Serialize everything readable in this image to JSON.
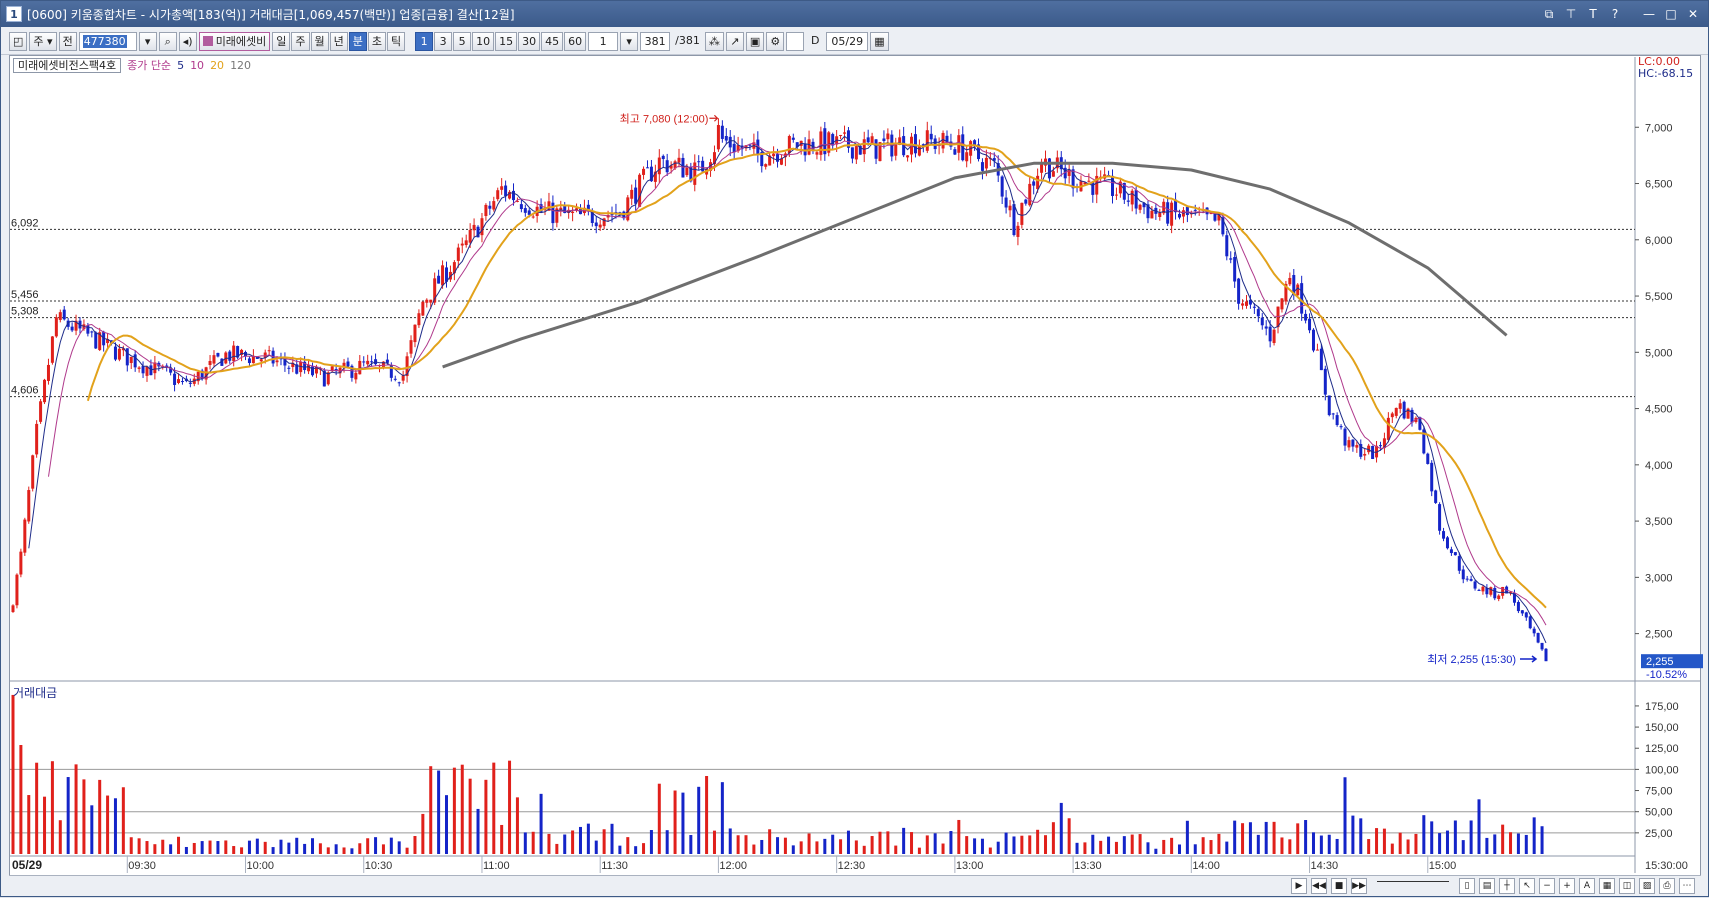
{
  "window": {
    "number": "1",
    "title": "[0600] 키움종합차트 - 시가총액[183(억)] 거래대금[1,069,457(백만)] 업종[금융] 결산[12월]",
    "buttons": [
      "restore-icon",
      "pin-icon",
      "font-icon",
      "help-icon",
      "minimize-icon",
      "maximize-icon",
      "close-icon"
    ]
  },
  "toolbar": {
    "type_select": "주",
    "all_label": "전",
    "stock_code": "477380",
    "stock_name": "미래에셋비",
    "periods": [
      "일",
      "주",
      "월",
      "년",
      "분",
      "초",
      "틱"
    ],
    "selected_period": "분",
    "intervals": [
      "1",
      "3",
      "5",
      "10",
      "15",
      "30",
      "45",
      "60"
    ],
    "selected_interval": "1",
    "interval_input": "1",
    "count_current": "381",
    "count_total": "/381",
    "date_checkbox_label": "D",
    "date_value": "05/29"
  },
  "price_panel": {
    "stock_name": "미래에셋비전스팩4호",
    "ma_label": "종가 단순",
    "ma_periods": [
      {
        "label": "5",
        "color": "#1f2d8a"
      },
      {
        "label": "10",
        "color": "#b03a8c"
      },
      {
        "label": "20",
        "color": "#e2a21b"
      },
      {
        "label": "120",
        "color": "#777777"
      }
    ],
    "lc": "LC:0.00",
    "hc": "HC:-68.15",
    "high_annotation": "최고 7,080 (12:00)",
    "low_annotation": "최저 2,255 (15:30)",
    "current_price": "2,255",
    "current_change": "-10.52%"
  },
  "volume_panel": {
    "title": "거래대금"
  },
  "time_axis": {
    "date_label": "05/29",
    "end_label": "15:30:00"
  },
  "colors": {
    "up": "#e0201b",
    "down": "#1424c8",
    "ma5": "#1f2d8a",
    "ma10": "#b03a8c",
    "ma20": "#e2a21b",
    "ma120": "#6e6e6e",
    "price_box": "#2457c8"
  },
  "chart_data": [
    {
      "type": "candlestick",
      "title": "미래에셋비전스팩4호",
      "x_ticks": [
        "09:30",
        "10:00",
        "10:30",
        "11:00",
        "11:30",
        "12:00",
        "12:30",
        "13:00",
        "13:30",
        "14:00",
        "14:30",
        "15:00"
      ],
      "y_ticks": [
        "7,000",
        "6,500",
        "6,000",
        "5,500",
        "5,000",
        "4,500",
        "4,000",
        "3,500",
        "3,000",
        "2,500"
      ],
      "ylim": [
        2150,
        7500
      ],
      "y_scale": "linear",
      "grid": false,
      "horizontal_levels": [
        {
          "label": "6,092",
          "value": 6092
        },
        {
          "label": "5,456",
          "value": 5456
        },
        {
          "label": "5,308",
          "value": 5308
        },
        {
          "label": "4,606",
          "value": 4606
        }
      ],
      "high": {
        "value": 7080,
        "time": "12:00"
      },
      "low": {
        "value": 2255,
        "time": "15:30"
      },
      "close": 2255,
      "change_pct": -10.52,
      "path_points": [
        {
          "t": "09:01",
          "p": 2800
        },
        {
          "t": "09:03",
          "p": 3200
        },
        {
          "t": "09:07",
          "p": 4300
        },
        {
          "t": "09:12",
          "p": 5300
        },
        {
          "t": "09:20",
          "p": 5150
        },
        {
          "t": "09:30",
          "p": 4950
        },
        {
          "t": "09:40",
          "p": 4800
        },
        {
          "t": "09:45",
          "p": 4700
        },
        {
          "t": "09:55",
          "p": 4980
        },
        {
          "t": "10:05",
          "p": 4950
        },
        {
          "t": "10:20",
          "p": 4780
        },
        {
          "t": "10:30",
          "p": 4880
        },
        {
          "t": "10:40",
          "p": 4800
        },
        {
          "t": "10:45",
          "p": 5450
        },
        {
          "t": "10:55",
          "p": 5900
        },
        {
          "t": "11:05",
          "p": 6450
        },
        {
          "t": "11:15",
          "p": 6250
        },
        {
          "t": "11:25",
          "p": 6200
        },
        {
          "t": "11:35",
          "p": 6250
        },
        {
          "t": "11:45",
          "p": 6700
        },
        {
          "t": "11:55",
          "p": 6600
        },
        {
          "t": "12:00",
          "p": 6900
        },
        {
          "t": "12:10",
          "p": 6750
        },
        {
          "t": "12:20",
          "p": 6850
        },
        {
          "t": "12:30",
          "p": 6850
        },
        {
          "t": "12:40",
          "p": 6820
        },
        {
          "t": "12:50",
          "p": 6880
        },
        {
          "t": "13:00",
          "p": 6850
        },
        {
          "t": "13:10",
          "p": 6650
        },
        {
          "t": "13:15",
          "p": 6150
        },
        {
          "t": "13:22",
          "p": 6700
        },
        {
          "t": "13:30",
          "p": 6550
        },
        {
          "t": "13:40",
          "p": 6450
        },
        {
          "t": "13:50",
          "p": 6250
        },
        {
          "t": "14:00",
          "p": 6200
        },
        {
          "t": "14:07",
          "p": 6150
        },
        {
          "t": "14:12",
          "p": 5500
        },
        {
          "t": "14:20",
          "p": 5150
        },
        {
          "t": "14:25",
          "p": 5700
        },
        {
          "t": "14:30",
          "p": 5250
        },
        {
          "t": "14:35",
          "p": 4500
        },
        {
          "t": "14:40",
          "p": 4150
        },
        {
          "t": "14:47",
          "p": 4100
        },
        {
          "t": "14:52",
          "p": 4550
        },
        {
          "t": "14:58",
          "p": 4350
        },
        {
          "t": "15:03",
          "p": 3450
        },
        {
          "t": "15:10",
          "p": 2950
        },
        {
          "t": "15:17",
          "p": 2850
        },
        {
          "t": "15:20",
          "p": 2900
        },
        {
          "t": "15:25",
          "p": 2600
        },
        {
          "t": "15:30",
          "p": 2255
        }
      ],
      "ma120_points": [
        {
          "t": "10:50",
          "p": 4870
        },
        {
          "t": "11:10",
          "p": 5120
        },
        {
          "t": "11:40",
          "p": 5450
        },
        {
          "t": "12:10",
          "p": 5850
        },
        {
          "t": "12:40",
          "p": 6270
        },
        {
          "t": "13:00",
          "p": 6550
        },
        {
          "t": "13:20",
          "p": 6680
        },
        {
          "t": "13:40",
          "p": 6680
        },
        {
          "t": "14:00",
          "p": 6620
        },
        {
          "t": "14:20",
          "p": 6450
        },
        {
          "t": "14:40",
          "p": 6150
        },
        {
          "t": "15:00",
          "p": 5750
        },
        {
          "t": "15:20",
          "p": 5150
        }
      ]
    },
    {
      "type": "bar",
      "title": "거래대금",
      "y_ticks": [
        "175,00",
        "150,00",
        "125,00",
        "100,00",
        "75,00",
        "50,00",
        "25,00"
      ],
      "ylim": [
        0,
        195
      ],
      "reference_lines": [
        100,
        50,
        25
      ],
      "bursts": [
        {
          "start": "09:01",
          "end": "09:30",
          "level": 105
        },
        {
          "start": "09:30",
          "end": "10:45",
          "level": 18
        },
        {
          "start": "10:45",
          "end": "11:10",
          "level": 95
        },
        {
          "start": "11:10",
          "end": "11:45",
          "level": 30
        },
        {
          "start": "11:45",
          "end": "11:55",
          "level": 70
        },
        {
          "start": "11:55",
          "end": "12:05",
          "level": 80
        },
        {
          "start": "12:05",
          "end": "13:10",
          "level": 25
        },
        {
          "start": "13:10",
          "end": "13:30",
          "level": 40
        },
        {
          "start": "13:30",
          "end": "14:10",
          "level": 20
        },
        {
          "start": "14:10",
          "end": "15:30",
          "level": 40
        }
      ]
    }
  ]
}
